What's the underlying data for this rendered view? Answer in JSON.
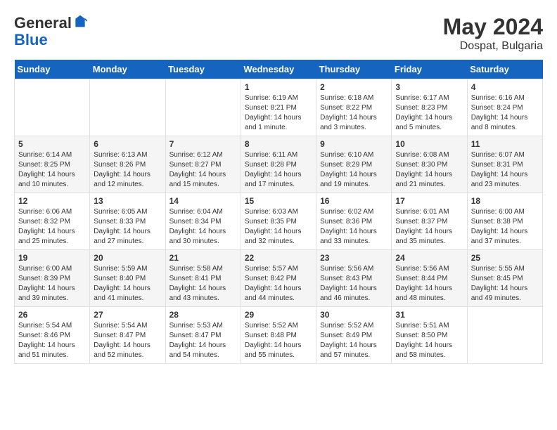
{
  "header": {
    "logo_general": "General",
    "logo_blue": "Blue",
    "month_year": "May 2024",
    "location": "Dospat, Bulgaria"
  },
  "weekdays": [
    "Sunday",
    "Monday",
    "Tuesday",
    "Wednesday",
    "Thursday",
    "Friday",
    "Saturday"
  ],
  "weeks": [
    [
      {
        "day": "",
        "info": ""
      },
      {
        "day": "",
        "info": ""
      },
      {
        "day": "",
        "info": ""
      },
      {
        "day": "1",
        "info": "Sunrise: 6:19 AM\nSunset: 8:21 PM\nDaylight: 14 hours\nand 1 minute."
      },
      {
        "day": "2",
        "info": "Sunrise: 6:18 AM\nSunset: 8:22 PM\nDaylight: 14 hours\nand 3 minutes."
      },
      {
        "day": "3",
        "info": "Sunrise: 6:17 AM\nSunset: 8:23 PM\nDaylight: 14 hours\nand 5 minutes."
      },
      {
        "day": "4",
        "info": "Sunrise: 6:16 AM\nSunset: 8:24 PM\nDaylight: 14 hours\nand 8 minutes."
      }
    ],
    [
      {
        "day": "5",
        "info": "Sunrise: 6:14 AM\nSunset: 8:25 PM\nDaylight: 14 hours\nand 10 minutes."
      },
      {
        "day": "6",
        "info": "Sunrise: 6:13 AM\nSunset: 8:26 PM\nDaylight: 14 hours\nand 12 minutes."
      },
      {
        "day": "7",
        "info": "Sunrise: 6:12 AM\nSunset: 8:27 PM\nDaylight: 14 hours\nand 15 minutes."
      },
      {
        "day": "8",
        "info": "Sunrise: 6:11 AM\nSunset: 8:28 PM\nDaylight: 14 hours\nand 17 minutes."
      },
      {
        "day": "9",
        "info": "Sunrise: 6:10 AM\nSunset: 8:29 PM\nDaylight: 14 hours\nand 19 minutes."
      },
      {
        "day": "10",
        "info": "Sunrise: 6:08 AM\nSunset: 8:30 PM\nDaylight: 14 hours\nand 21 minutes."
      },
      {
        "day": "11",
        "info": "Sunrise: 6:07 AM\nSunset: 8:31 PM\nDaylight: 14 hours\nand 23 minutes."
      }
    ],
    [
      {
        "day": "12",
        "info": "Sunrise: 6:06 AM\nSunset: 8:32 PM\nDaylight: 14 hours\nand 25 minutes."
      },
      {
        "day": "13",
        "info": "Sunrise: 6:05 AM\nSunset: 8:33 PM\nDaylight: 14 hours\nand 27 minutes."
      },
      {
        "day": "14",
        "info": "Sunrise: 6:04 AM\nSunset: 8:34 PM\nDaylight: 14 hours\nand 30 minutes."
      },
      {
        "day": "15",
        "info": "Sunrise: 6:03 AM\nSunset: 8:35 PM\nDaylight: 14 hours\nand 32 minutes."
      },
      {
        "day": "16",
        "info": "Sunrise: 6:02 AM\nSunset: 8:36 PM\nDaylight: 14 hours\nand 33 minutes."
      },
      {
        "day": "17",
        "info": "Sunrise: 6:01 AM\nSunset: 8:37 PM\nDaylight: 14 hours\nand 35 minutes."
      },
      {
        "day": "18",
        "info": "Sunrise: 6:00 AM\nSunset: 8:38 PM\nDaylight: 14 hours\nand 37 minutes."
      }
    ],
    [
      {
        "day": "19",
        "info": "Sunrise: 6:00 AM\nSunset: 8:39 PM\nDaylight: 14 hours\nand 39 minutes."
      },
      {
        "day": "20",
        "info": "Sunrise: 5:59 AM\nSunset: 8:40 PM\nDaylight: 14 hours\nand 41 minutes."
      },
      {
        "day": "21",
        "info": "Sunrise: 5:58 AM\nSunset: 8:41 PM\nDaylight: 14 hours\nand 43 minutes."
      },
      {
        "day": "22",
        "info": "Sunrise: 5:57 AM\nSunset: 8:42 PM\nDaylight: 14 hours\nand 44 minutes."
      },
      {
        "day": "23",
        "info": "Sunrise: 5:56 AM\nSunset: 8:43 PM\nDaylight: 14 hours\nand 46 minutes."
      },
      {
        "day": "24",
        "info": "Sunrise: 5:56 AM\nSunset: 8:44 PM\nDaylight: 14 hours\nand 48 minutes."
      },
      {
        "day": "25",
        "info": "Sunrise: 5:55 AM\nSunset: 8:45 PM\nDaylight: 14 hours\nand 49 minutes."
      }
    ],
    [
      {
        "day": "26",
        "info": "Sunrise: 5:54 AM\nSunset: 8:46 PM\nDaylight: 14 hours\nand 51 minutes."
      },
      {
        "day": "27",
        "info": "Sunrise: 5:54 AM\nSunset: 8:47 PM\nDaylight: 14 hours\nand 52 minutes."
      },
      {
        "day": "28",
        "info": "Sunrise: 5:53 AM\nSunset: 8:47 PM\nDaylight: 14 hours\nand 54 minutes."
      },
      {
        "day": "29",
        "info": "Sunrise: 5:52 AM\nSunset: 8:48 PM\nDaylight: 14 hours\nand 55 minutes."
      },
      {
        "day": "30",
        "info": "Sunrise: 5:52 AM\nSunset: 8:49 PM\nDaylight: 14 hours\nand 57 minutes."
      },
      {
        "day": "31",
        "info": "Sunrise: 5:51 AM\nSunset: 8:50 PM\nDaylight: 14 hours\nand 58 minutes."
      },
      {
        "day": "",
        "info": ""
      }
    ]
  ]
}
